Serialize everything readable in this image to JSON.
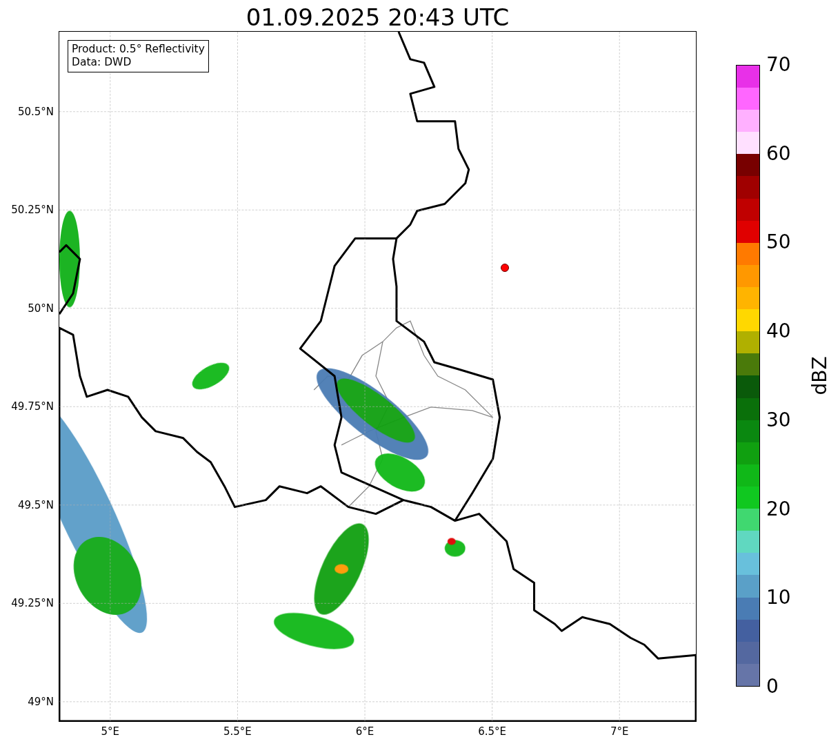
{
  "title": "01.09.2025 20:43 UTC",
  "map": {
    "info_lines": [
      "Product: 0.5° Reflectivity",
      "Data: DWD"
    ],
    "yticks": [
      "50.5°N",
      "50.25°N",
      "50°N",
      "49.75°N",
      "49.5°N",
      "49.25°N",
      "49°N"
    ],
    "xticks": [
      "5°E",
      "5.5°E",
      "6°E",
      "6.5°E",
      "7°E"
    ]
  },
  "colorbar": {
    "label": "dBZ",
    "ticks": [
      "70",
      "60",
      "50",
      "40",
      "30",
      "20",
      "10",
      "0"
    ],
    "bins": [
      {
        "color": "#6675a8"
      },
      {
        "color": "#5468a0"
      },
      {
        "color": "#4460a0"
      },
      {
        "color": "#4a7cb4"
      },
      {
        "color": "#5aa0c8"
      },
      {
        "color": "#68c0dc"
      },
      {
        "color": "#60d8c0"
      },
      {
        "color": "#40d870"
      },
      {
        "color": "#10c820"
      },
      {
        "color": "#10b818"
      },
      {
        "color": "#10a010"
      },
      {
        "color": "#0a8810"
      },
      {
        "color": "#0a700a"
      },
      {
        "color": "#0a5a0a"
      },
      {
        "color": "#4a7a0a"
      },
      {
        "color": "#b0b000"
      },
      {
        "color": "#ffd800"
      },
      {
        "color": "#ffb400"
      },
      {
        "color": "#ff9800"
      },
      {
        "color": "#ff7a00"
      },
      {
        "color": "#e00000"
      },
      {
        "color": "#c00000"
      },
      {
        "color": "#a00000"
      },
      {
        "color": "#780000"
      },
      {
        "color": "#ffe0ff"
      },
      {
        "color": "#ffb0ff"
      },
      {
        "color": "#ff66ff"
      },
      {
        "color": "#e830e8"
      }
    ]
  }
}
